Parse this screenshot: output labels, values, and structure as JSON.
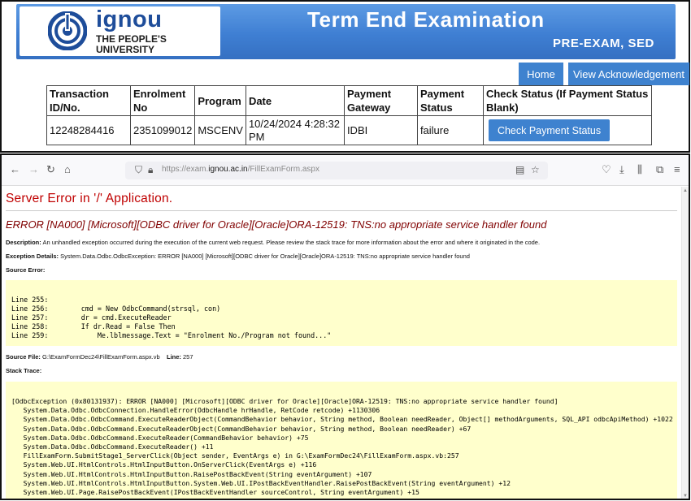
{
  "banner": {
    "logo_word": "ignou",
    "logo_line1": "THE PEOPLE'S",
    "logo_line2": "UNIVERSITY",
    "title": "Term End Examination",
    "subtitle": "PRE-EXAM, SED",
    "color": "#3f7fd3"
  },
  "nav": {
    "home": "Home",
    "view_ack": "View Acknowledgement"
  },
  "table": {
    "headers": [
      "Transaction ID/No.",
      "Enrolment No",
      "Program",
      "Date",
      "Payment Gateway",
      "Payment Status",
      "Check Status (If Payment Status Blank)"
    ],
    "row": {
      "transaction_id": "12248284416",
      "enrolment_no": "2351099012",
      "program": "MSCENV",
      "date": "10/24/2024 4:28:32 PM",
      "gateway": "IDBI",
      "status": "failure",
      "button": "Check Payment Status"
    }
  },
  "browser": {
    "url_prefix": "https://exam.",
    "url_domain": "ignou.ac.in",
    "url_path": "/FillExamForm.aspx",
    "icons": [
      "back-icon",
      "forward-icon",
      "reload-icon",
      "home-icon",
      "shield-icon",
      "lock-icon",
      "reader-view-icon",
      "star-icon",
      "pocket-icon",
      "download-icon",
      "library-icon",
      "extensions-icon",
      "menu-icon"
    ]
  },
  "error": {
    "heading": "Server Error in '/' Application.",
    "message": "ERROR [NA000] [Microsoft][ODBC driver for Oracle][Oracle]ORA-12519: TNS:no appropriate service handler found",
    "description_label": "Description:",
    "description": "An unhandled exception occurred during the execution of the current web request. Please review the stack trace for more information about the error and where it originated in the code.",
    "exception_label": "Exception Details:",
    "exception": "System.Data.Odbc.OdbcException: ERROR [NA000] [Microsoft][ODBC driver for Oracle][Oracle]ORA-12519: TNS:no appropriate service handler found",
    "source_error_label": "Source Error:",
    "source_lines": [
      {
        "text": "Line 255:",
        "highlight": false
      },
      {
        "text": "Line 256:        cmd = New OdbcCommand(strsql, con)",
        "highlight": false
      },
      {
        "text": "Line 257:        dr = cmd.ExecuteReader",
        "highlight": true
      },
      {
        "text": "Line 258:        If dr.Read = False Then",
        "highlight": false
      },
      {
        "text": "Line 259:            Me.lblmessage.Text = \"Enrolment No./Program not found...\"",
        "highlight": false
      }
    ],
    "source_file_label": "Source File:",
    "source_file": "G:\\ExamFormDec24\\FillExamForm.aspx.vb",
    "line_label": "Line:",
    "line_no": "257",
    "stack_label": "Stack Trace:",
    "stack": [
      "[OdbcException (0x80131937): ERROR [NA000] [Microsoft][ODBC driver for Oracle][Oracle]ORA-12519: TNS:no appropriate service handler found]",
      "   System.Data.Odbc.OdbcConnection.HandleError(OdbcHandle hrHandle, RetCode retcode) +1130306",
      "   System.Data.Odbc.OdbcCommand.ExecuteReaderObject(CommandBehavior behavior, String method, Boolean needReader, Object[] methodArguments, SQL_API odbcApiMethod) +1022",
      "   System.Data.Odbc.OdbcCommand.ExecuteReaderObject(CommandBehavior behavior, String method, Boolean needReader) +67",
      "   System.Data.Odbc.OdbcCommand.ExecuteReader(CommandBehavior behavior) +75",
      "   System.Data.Odbc.OdbcCommand.ExecuteReader() +11",
      "   FillExamForm.SubmitStage1_ServerClick(Object sender, EventArgs e) in G:\\ExamFormDec24\\FillExamForm.aspx.vb:257",
      "   System.Web.UI.HtmlControls.HtmlInputButton.OnServerClick(EventArgs e) +116",
      "   System.Web.UI.HtmlControls.HtmlInputButton.RaisePostBackEvent(String eventArgument) +107",
      "   System.Web.UI.HtmlControls.HtmlInputButton.System.Web.UI.IPostBackEventHandler.RaisePostBackEvent(String eventArgument) +12",
      "   System.Web.UI.Page.RaisePostBackEvent(IPostBackEventHandler sourceControl, String eventArgument) +15"
    ]
  }
}
